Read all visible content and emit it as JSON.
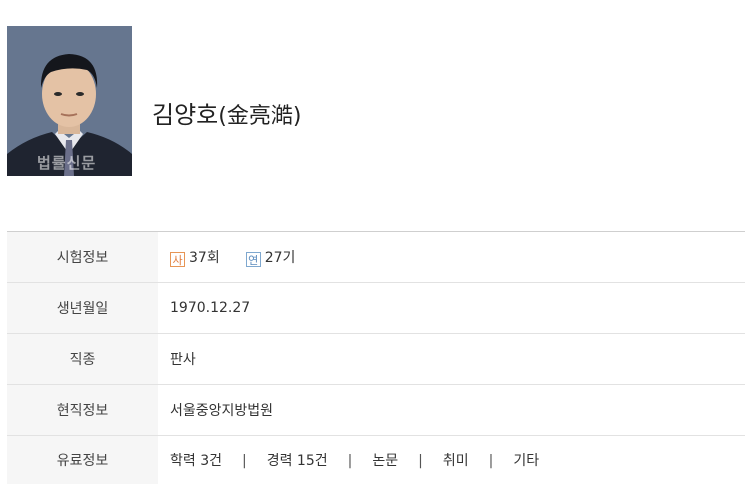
{
  "profile": {
    "name": "김양호",
    "hanja": "(金亮澔)",
    "photo_watermark": "법률신문"
  },
  "rows": {
    "exam": {
      "label": "시험정보",
      "sa_badge": "사",
      "sa_value": "37회",
      "yeon_badge": "연",
      "yeon_value": "27기"
    },
    "birth": {
      "label": "생년월일",
      "value": "1970.12.27"
    },
    "job": {
      "label": "직종",
      "value": "판사"
    },
    "current": {
      "label": "현직정보",
      "value": "서울중앙지방법원"
    },
    "paid": {
      "label": "유료정보",
      "links": [
        "학력 3건",
        "경력 15건",
        "논문",
        "취미",
        "기타"
      ],
      "separator": "|"
    }
  },
  "colors": {
    "sa_badge": "#e07a3a",
    "yeon_badge": "#5b8bbd",
    "label_bg": "#f6f6f6"
  }
}
